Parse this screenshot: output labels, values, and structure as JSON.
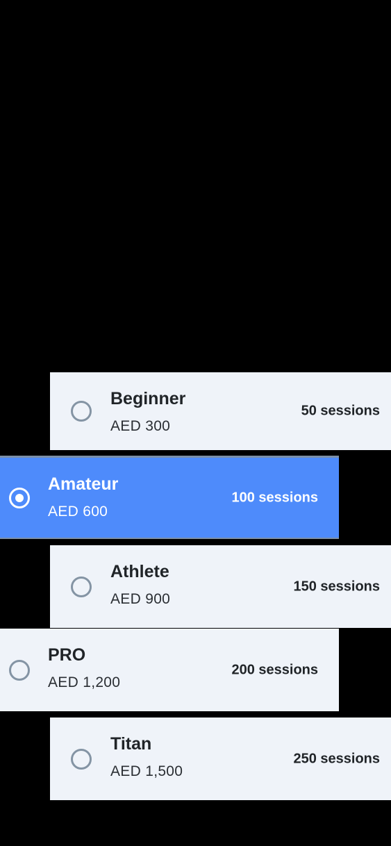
{
  "plans": [
    {
      "name": "Beginner",
      "price": "AED 300",
      "sessions": "50 sessions",
      "selected": false
    },
    {
      "name": "Amateur",
      "price": "AED 600",
      "sessions": "100 sessions",
      "selected": true
    },
    {
      "name": "Athlete",
      "price": "AED 900",
      "sessions": "150 sessions",
      "selected": false
    },
    {
      "name": "PRO",
      "price": "AED 1,200",
      "sessions": "200 sessions",
      "selected": false
    },
    {
      "name": "Titan",
      "price": "AED 1,500",
      "sessions": "250 sessions",
      "selected": false
    }
  ],
  "colors": {
    "background": "#000000",
    "card": "#eff3f9",
    "selected_card": "#4e8bfb",
    "radio_border": "#8494a4",
    "text": "#202428"
  }
}
